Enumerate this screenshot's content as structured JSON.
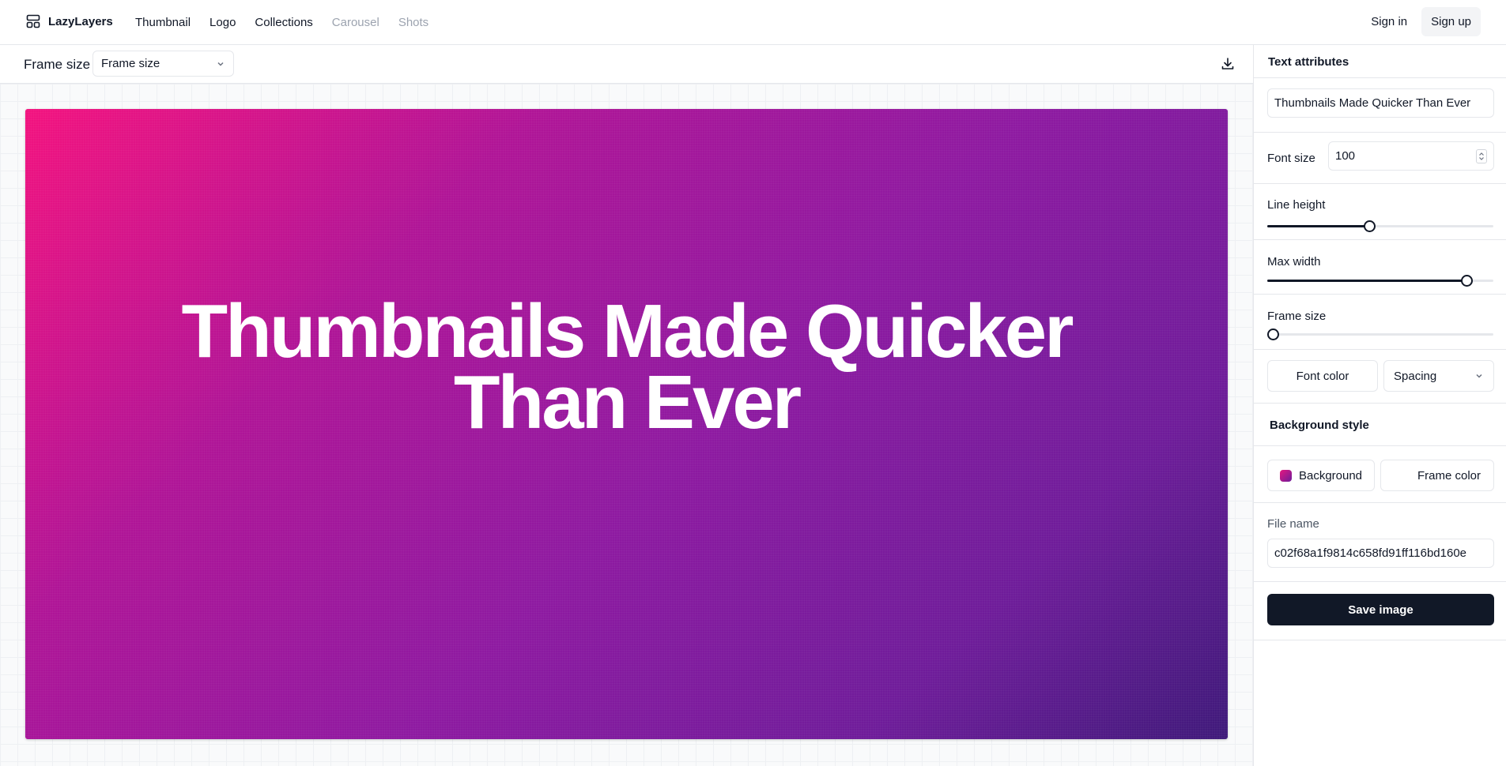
{
  "nav": {
    "brand": "LazyLayers",
    "links": [
      {
        "label": "Thumbnail",
        "disabled": false
      },
      {
        "label": "Logo",
        "disabled": false
      },
      {
        "label": "Collections",
        "disabled": false
      },
      {
        "label": "Carousel",
        "disabled": true
      },
      {
        "label": "Shots",
        "disabled": true
      }
    ],
    "sign_in": "Sign in",
    "sign_up": "Sign up"
  },
  "toolbar": {
    "label": "Frame size",
    "select_value": "Frame size",
    "download_icon": "download-icon"
  },
  "canvas": {
    "title": "Thumbnails Made Quicker Than Ever",
    "gradient_colors": [
      "#f3137f",
      "#8e1aa1",
      "#3f1a7a"
    ]
  },
  "panel": {
    "text_attributes_title": "Text attributes",
    "text_value": "Thumbnails Made Quicker Than Ever",
    "font_size_label": "Font size",
    "font_size_value": "100",
    "line_height_label": "Line height",
    "line_height_level": 0.45,
    "max_width_label": "Max width",
    "max_width_level": 0.88,
    "frame_size_label": "Frame size",
    "frame_size_level": 0.0,
    "font_color_button": "Font color",
    "spacing_select": "Spacing",
    "background_style_title": "Background style",
    "background_button": "Background",
    "frame_color_button": "Frame color",
    "file_name_label": "File name",
    "file_name_value": "c02f68a1f9814c658fd91ff116bd160e",
    "save_button": "Save image"
  },
  "colors": {
    "primary_dark": "#111827",
    "border": "#e5e7eb",
    "muted": "#9ca3af"
  }
}
